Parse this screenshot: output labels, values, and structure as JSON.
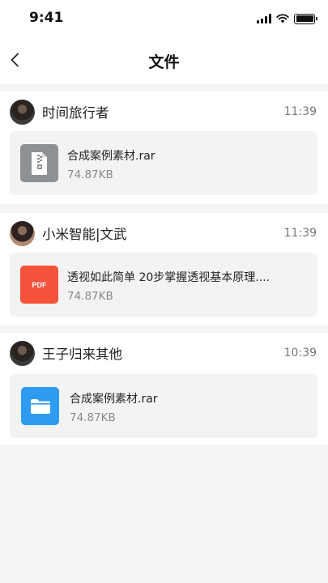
{
  "status_bar": {
    "time": "9:41"
  },
  "header": {
    "title": "文件"
  },
  "messages": [
    {
      "sender": "时间旅行者",
      "time": "11:39",
      "file": {
        "name": "合成案例素材.rar",
        "size": "74.87KB",
        "icon": "zip-archive-icon",
        "color": "#8e9193"
      }
    },
    {
      "sender": "小米智能|文武",
      "time": "11:39",
      "file": {
        "name": "透视如此简单 20步掌握透视基本原理....",
        "size": "74.87KB",
        "icon": "pdf-icon",
        "color": "#f4523b",
        "icon_text": "PDF"
      }
    },
    {
      "sender": "王子归来其他",
      "time": "10:39",
      "file": {
        "name": "合成案例素材.rar",
        "size": "74.87KB",
        "icon": "folder-icon",
        "color": "#2e9bf0"
      }
    }
  ]
}
